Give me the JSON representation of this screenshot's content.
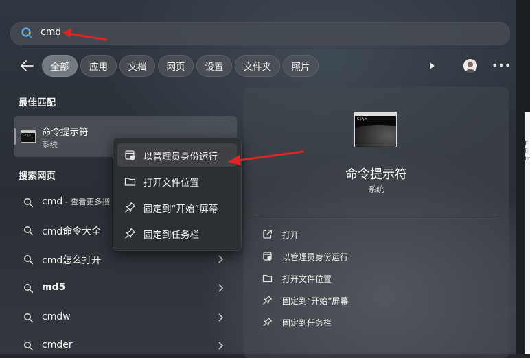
{
  "search": {
    "query": "cmd"
  },
  "filters": [
    "全部",
    "应用",
    "文档",
    "网页",
    "设置",
    "文件夹",
    "照片"
  ],
  "sections": {
    "best_match": "最佳匹配",
    "web_search": "搜索网页"
  },
  "best_match": {
    "title": "命令提示符",
    "subtitle": "系统",
    "icon_text": "C:\\>_"
  },
  "web_results": [
    {
      "text": "cmd",
      "hint": " - 查看更多搜"
    },
    {
      "text": "cmd命令大全"
    },
    {
      "text": "cmd怎么打开"
    },
    {
      "text": "md5"
    },
    {
      "text": "cmdw"
    },
    {
      "text": "cmder"
    }
  ],
  "context_menu": [
    "以管理员身份运行",
    "打开文件位置",
    "固定到“开始”屏幕",
    "固定到任务栏"
  ],
  "detail": {
    "title": "命令提示符",
    "subtitle": "系统",
    "actions": [
      "打开",
      "以管理员身份运行",
      "打开文件位置",
      "固定到“开始”屏幕",
      "固定到任务栏"
    ]
  },
  "colors": {
    "annotation_arrow": "#e02424",
    "active_chip": "#737a80"
  }
}
